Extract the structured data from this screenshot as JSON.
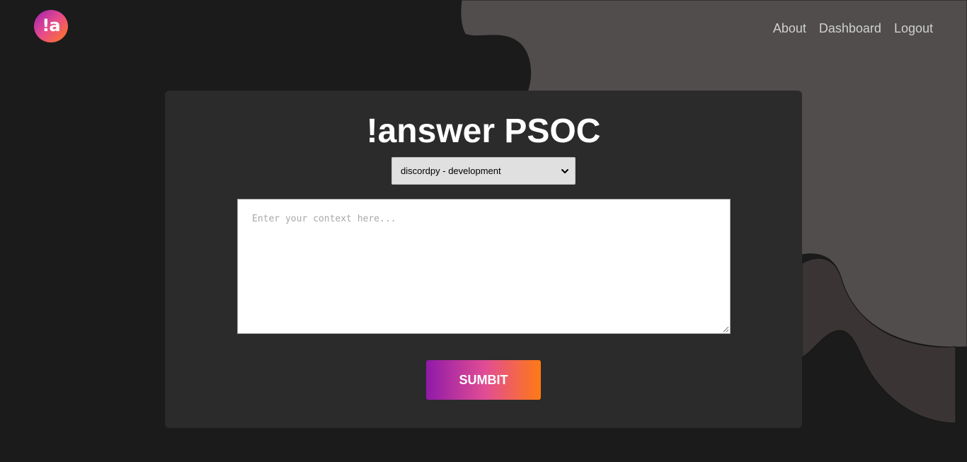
{
  "brand": {
    "logo_text": "!a",
    "gradient": [
      "#9b21b0",
      "#e64a8d",
      "#ff7a1a"
    ]
  },
  "nav": {
    "items": [
      {
        "label": "About"
      },
      {
        "label": "Dashboard"
      },
      {
        "label": "Logout"
      }
    ]
  },
  "form": {
    "title": "!answer PSOC",
    "select": {
      "selected": "discordpy - development"
    },
    "context": {
      "placeholder": "Enter your context here...",
      "value": ""
    },
    "submit_label": "SUMBIT"
  },
  "colors": {
    "background": "#1b1b1b",
    "card": "#2b2b2b",
    "shape_light": "#504d4c",
    "shape_mid": "#3a3534"
  }
}
